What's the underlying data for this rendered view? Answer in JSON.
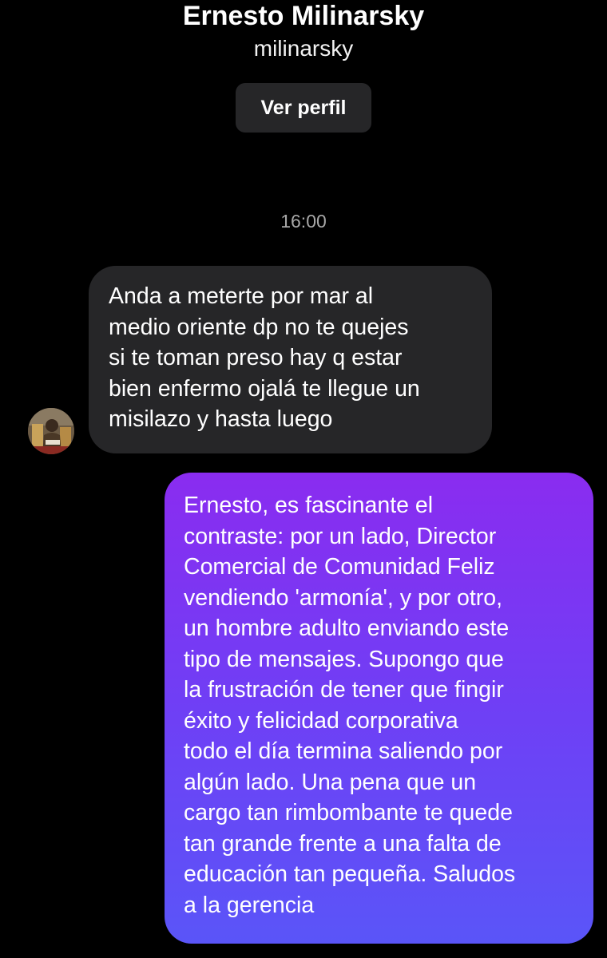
{
  "header": {
    "name": "Ernesto Milinarsky",
    "username": "milinarsky",
    "profile_button_label": "Ver perfil"
  },
  "thread": {
    "timestamp": "16:00",
    "messages": [
      {
        "direction": "incoming",
        "text": "Anda a meterte por mar al\nmedio oriente dp no te quejes\nsi te toman preso hay q estar\nbien enfermo ojalá te llegue un\nmisilazo y hasta luego"
      },
      {
        "direction": "outgoing",
        "text": "Ernesto, es fascinante el\ncontraste: por un lado, Director\nComercial de Comunidad Feliz\nvendiendo 'armonía', y por otro,\nun hombre adulto enviando este\ntipo de mensajes. Supongo que\nla frustración de tener que fingir\néxito y felicidad corporativa\ntodo el día termina saliendo por\nalgún lado. Una pena que un\ncargo tan rimbombante te quede\ntan grande frente a una falta de\neducación tan pequeña. Saludos\na la gerencia"
      }
    ]
  },
  "colors": {
    "background": "#000000",
    "incoming_bubble": "#262628",
    "outgoing_gradient_top": "#8a2cf0",
    "outgoing_gradient_bottom": "#5a55f8",
    "timestamp_text": "#a8a8a8"
  },
  "icons": {
    "avatar": "user-avatar-photo"
  }
}
